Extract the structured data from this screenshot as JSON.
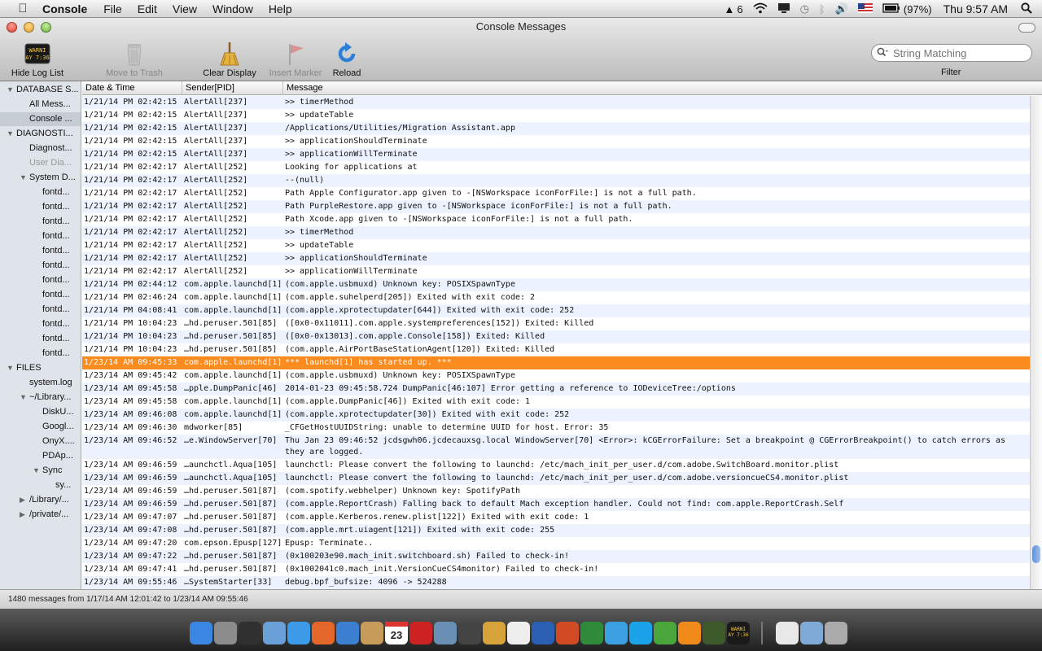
{
  "menubar": {
    "app_name": "Console",
    "items": [
      "File",
      "Edit",
      "View",
      "Window",
      "Help"
    ],
    "status": {
      "input_badge": "6",
      "battery": "(97%)",
      "clock": "Thu 9:57 AM"
    }
  },
  "window": {
    "title": "Console Messages"
  },
  "toolbar": {
    "hide_log_list": "Hide Log List",
    "move_to_trash": "Move to Trash",
    "clear_display": "Clear Display",
    "insert_marker": "Insert Marker",
    "reload": "Reload",
    "search_placeholder": "String Matching",
    "filter_label": "Filter",
    "badge_text_1": "WARNI",
    "badge_text_2": "AY 7:36"
  },
  "sidebar": {
    "items": [
      {
        "label": "DATABASE S...",
        "level": 0,
        "disclosure": "open"
      },
      {
        "label": "All Mess...",
        "level": 1
      },
      {
        "label": "Console ...",
        "level": 1,
        "selected": true
      },
      {
        "label": "DIAGNOSTI...",
        "level": 0,
        "disclosure": "open"
      },
      {
        "label": "Diagnost...",
        "level": 1
      },
      {
        "label": "User Dia...",
        "level": 1,
        "dimmed": true
      },
      {
        "label": "System D...",
        "level": 1,
        "disclosure": "open"
      },
      {
        "label": "fontd...",
        "level": 2
      },
      {
        "label": "fontd...",
        "level": 2
      },
      {
        "label": "fontd...",
        "level": 2
      },
      {
        "label": "fontd...",
        "level": 2
      },
      {
        "label": "fontd...",
        "level": 2
      },
      {
        "label": "fontd...",
        "level": 2
      },
      {
        "label": "fontd...",
        "level": 2
      },
      {
        "label": "fontd...",
        "level": 2
      },
      {
        "label": "fontd...",
        "level": 2
      },
      {
        "label": "fontd...",
        "level": 2
      },
      {
        "label": "fontd...",
        "level": 2
      },
      {
        "label": "fontd...",
        "level": 2
      },
      {
        "label": "FILES",
        "level": 0,
        "disclosure": "open"
      },
      {
        "label": "system.log",
        "level": 1
      },
      {
        "label": "~/Library...",
        "level": 1,
        "disclosure": "open"
      },
      {
        "label": "DiskU...",
        "level": 2
      },
      {
        "label": "Googl...",
        "level": 2
      },
      {
        "label": "OnyX....",
        "level": 2
      },
      {
        "label": "PDAp...",
        "level": 2
      },
      {
        "label": "Sync",
        "level": 2,
        "disclosure": "open"
      },
      {
        "label": "sy...",
        "level": 3
      },
      {
        "label": "/Library/...",
        "level": 1,
        "disclosure": "closed"
      },
      {
        "label": "/private/...",
        "level": 1,
        "disclosure": "closed"
      }
    ]
  },
  "table": {
    "columns": [
      "Date & Time",
      "Sender[PID]",
      "Message"
    ],
    "rows": [
      [
        "1/21/14 PM 02:42:15",
        "AlertAll[237]",
        ">> timerMethod"
      ],
      [
        "1/21/14 PM 02:42:15",
        "AlertAll[237]",
        ">> updateTable"
      ],
      [
        "1/21/14 PM 02:42:15",
        "AlertAll[237]",
        "/Applications/Utilities/Migration Assistant.app"
      ],
      [
        "1/21/14 PM 02:42:15",
        "AlertAll[237]",
        ">> applicationShouldTerminate"
      ],
      [
        "1/21/14 PM 02:42:15",
        "AlertAll[237]",
        ">> applicationWillTerminate"
      ],
      [
        "1/21/14 PM 02:42:17",
        "AlertAll[252]",
        "Looking for applications at"
      ],
      [
        "1/21/14 PM 02:42:17",
        "AlertAll[252]",
        "--(null)"
      ],
      [
        "1/21/14 PM 02:42:17",
        "AlertAll[252]",
        "Path Apple Configurator.app given to -[NSWorkspace iconForFile:] is not a full path."
      ],
      [
        "1/21/14 PM 02:42:17",
        "AlertAll[252]",
        "Path PurpleRestore.app given to -[NSWorkspace iconForFile:] is not a full path."
      ],
      [
        "1/21/14 PM 02:42:17",
        "AlertAll[252]",
        "Path Xcode.app given to -[NSWorkspace iconForFile:] is not a full path."
      ],
      [
        "1/21/14 PM 02:42:17",
        "AlertAll[252]",
        ">> timerMethod"
      ],
      [
        "1/21/14 PM 02:42:17",
        "AlertAll[252]",
        ">> updateTable"
      ],
      [
        "1/21/14 PM 02:42:17",
        "AlertAll[252]",
        ">> applicationShouldTerminate"
      ],
      [
        "1/21/14 PM 02:42:17",
        "AlertAll[252]",
        ">> applicationWillTerminate"
      ],
      [
        "1/21/14 PM 02:44:12",
        "com.apple.launchd[1]",
        "(com.apple.usbmuxd) Unknown key: POSIXSpawnType"
      ],
      [
        "1/21/14 PM 02:46:24",
        "com.apple.launchd[1]",
        "(com.apple.suhelperd[205]) Exited with exit code: 2"
      ],
      [
        "1/21/14 PM 04:08:41",
        "com.apple.launchd[1]",
        "(com.apple.xprotectupdater[644]) Exited with exit code: 252"
      ],
      [
        "1/21/14 PM 10:04:23",
        "…hd.peruser.501[85]",
        "([0x0-0x11011].com.apple.systempreferences[152]) Exited: Killed"
      ],
      [
        "1/21/14 PM 10:04:23",
        "…hd.peruser.501[85]",
        "([0x0-0x13013].com.apple.Console[158]) Exited: Killed"
      ],
      [
        "1/21/14 PM 10:04:23",
        "…hd.peruser.501[85]",
        "(com.apple.AirPortBaseStationAgent[120]) Exited: Killed"
      ],
      [
        "1/23/14 AM 09:45:33",
        "com.apple.launchd[1]",
        "*** launchd[1] has started up. ***"
      ],
      [
        "1/23/14 AM 09:45:42",
        "com.apple.launchd[1]",
        "(com.apple.usbmuxd) Unknown key: POSIXSpawnType"
      ],
      [
        "1/23/14 AM 09:45:58",
        "…pple.DumpPanic[46]",
        "2014-01-23 09:45:58.724 DumpPanic[46:107] Error getting a reference to IODeviceTree:/options"
      ],
      [
        "1/23/14 AM 09:45:58",
        "com.apple.launchd[1]",
        "(com.apple.DumpPanic[46]) Exited with exit code: 1"
      ],
      [
        "1/23/14 AM 09:46:08",
        "com.apple.launchd[1]",
        "(com.apple.xprotectupdater[30]) Exited with exit code: 252"
      ],
      [
        "1/23/14 AM 09:46:30",
        "mdworker[85]",
        "_CFGetHostUUIDString: unable to determine UUID for host. Error: 35"
      ],
      [
        "1/23/14 AM 09:46:52",
        "…e.WindowServer[70]",
        "Thu Jan 23 09:46:52 jcdsgwh06.jcdecauxsg.local WindowServer[70] <Error>: kCGErrorFailure: Set a breakpoint @ CGErrorBreakpoint() to catch errors as they are logged."
      ],
      [
        "1/23/14 AM 09:46:59",
        "…aunchctl.Aqua[105]",
        "launchctl: Please convert the following to launchd: /etc/mach_init_per_user.d/com.adobe.SwitchBoard.monitor.plist"
      ],
      [
        "1/23/14 AM 09:46:59",
        "…aunchctl.Aqua[105]",
        "launchctl: Please convert the following to launchd: /etc/mach_init_per_user.d/com.adobe.versioncueCS4.monitor.plist"
      ],
      [
        "1/23/14 AM 09:46:59",
        "…hd.peruser.501[87]",
        "(com.spotify.webhelper) Unknown key: SpotifyPath"
      ],
      [
        "1/23/14 AM 09:46:59",
        "…hd.peruser.501[87]",
        "(com.apple.ReportCrash) Falling back to default Mach exception handler. Could not find: com.apple.ReportCrash.Self"
      ],
      [
        "1/23/14 AM 09:47:07",
        "…hd.peruser.501[87]",
        "(com.apple.Kerberos.renew.plist[122]) Exited with exit code: 1"
      ],
      [
        "1/23/14 AM 09:47:08",
        "…hd.peruser.501[87]",
        "(com.apple.mrt.uiagent[121]) Exited with exit code: 255"
      ],
      [
        "1/23/14 AM 09:47:20",
        "com.epson.Epusp[127]",
        "Epusp: Terminate.."
      ],
      [
        "1/23/14 AM 09:47:22",
        "…hd.peruser.501[87]",
        "(0x100203e90.mach_init.switchboard.sh) Failed to check-in!"
      ],
      [
        "1/23/14 AM 09:47:41",
        "…hd.peruser.501[87]",
        "(0x1002041c0.mach_init.VersionCueCS4monitor) Failed to check-in!"
      ],
      [
        "1/23/14 AM 09:55:46",
        "…SystemStarter[33]",
        "debug.bpf_bufsize: 4096 -> 524288"
      ]
    ],
    "selected_row": 20,
    "tall_rows": [
      26
    ]
  },
  "statusbar": {
    "text": "1480 messages from 1/17/14 AM 12:01:42 to 1/23/14 AM 09:55:46"
  },
  "dock": {
    "badge_text_1": "WARNI",
    "badge_text_2": "AY 7:36",
    "calendar_day": "23"
  }
}
